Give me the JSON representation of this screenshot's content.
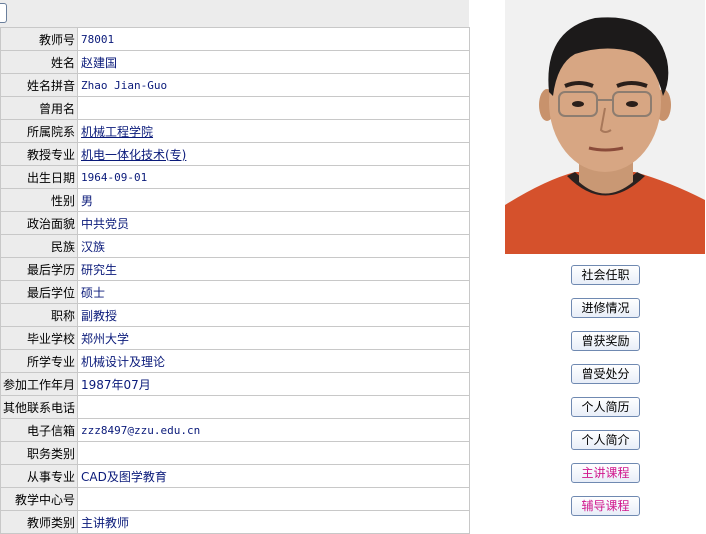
{
  "rows": [
    {
      "label": "教师号",
      "value": "78001",
      "kind": "mono"
    },
    {
      "label": "姓名",
      "value": "赵建国",
      "kind": "cjk"
    },
    {
      "label": "姓名拼音",
      "value": "Zhao Jian-Guo",
      "kind": "mono"
    },
    {
      "label": "曾用名",
      "value": "",
      "kind": "cjk"
    },
    {
      "label": "所属院系",
      "value": "机械工程学院",
      "kind": "link"
    },
    {
      "label": "教授专业",
      "value": "机电一体化技术(专)",
      "kind": "link"
    },
    {
      "label": "出生日期",
      "value": "1964-09-01",
      "kind": "mono"
    },
    {
      "label": "性别",
      "value": "男",
      "kind": "cjk"
    },
    {
      "label": "政治面貌",
      "value": "中共党员",
      "kind": "cjk"
    },
    {
      "label": "民族",
      "value": "汉族",
      "kind": "cjk"
    },
    {
      "label": "最后学历",
      "value": "研究生",
      "kind": "cjk"
    },
    {
      "label": "最后学位",
      "value": "硕士",
      "kind": "cjk"
    },
    {
      "label": "职称",
      "value": "副教授",
      "kind": "cjk"
    },
    {
      "label": "毕业学校",
      "value": "郑州大学",
      "kind": "cjk"
    },
    {
      "label": "所学专业",
      "value": "机械设计及理论",
      "kind": "cjk"
    },
    {
      "label": "参加工作年月",
      "value": "1987年07月",
      "kind": "cjk"
    },
    {
      "label": "其他联系电话",
      "value": "",
      "kind": "cjk"
    },
    {
      "label": "电子信箱",
      "value": "zzz8497@zzu.edu.cn",
      "kind": "mono"
    },
    {
      "label": "职务类别",
      "value": "",
      "kind": "cjk"
    },
    {
      "label": "从事专业",
      "value": "CAD及图学教育",
      "kind": "cjk"
    },
    {
      "label": "教学中心号",
      "value": "",
      "kind": "cjk"
    },
    {
      "label": "教师类别",
      "value": "主讲教师",
      "kind": "cjk"
    }
  ],
  "buttons": [
    {
      "label": "社会任职",
      "style": "normal"
    },
    {
      "label": "进修情况",
      "style": "normal"
    },
    {
      "label": "曾获奖励",
      "style": "normal"
    },
    {
      "label": "曾受处分",
      "style": "normal"
    },
    {
      "label": "个人简历",
      "style": "normal"
    },
    {
      "label": "个人简介",
      "style": "normal"
    },
    {
      "label": "主讲课程",
      "style": "pink"
    },
    {
      "label": "辅导课程",
      "style": "pink"
    }
  ],
  "colors": {
    "value_text": "#0a1a7a",
    "label_bg": "#ececec",
    "pink_button_text": "#d0168c"
  }
}
